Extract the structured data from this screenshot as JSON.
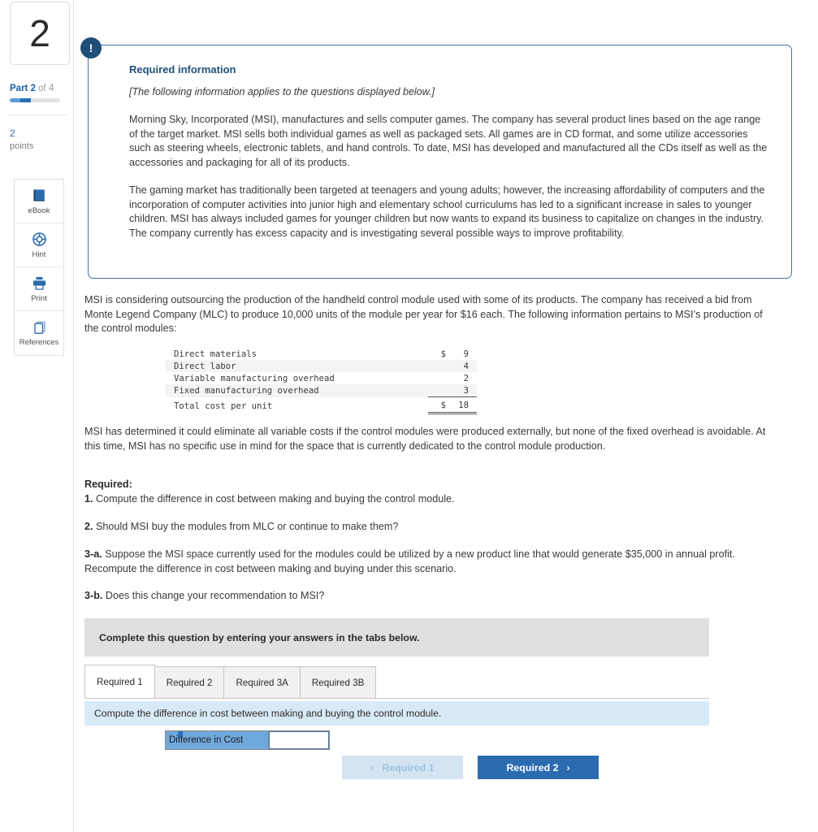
{
  "sidebar": {
    "question_number": "2",
    "part_prefix": "Part 2",
    "part_suffix": " of 4",
    "points_value": "2",
    "points_label": "points",
    "tools": [
      {
        "label": "eBook",
        "icon": "ebook-icon"
      },
      {
        "label": "Hint",
        "icon": "lifebuoy-icon"
      },
      {
        "label": "Print",
        "icon": "printer-icon"
      },
      {
        "label": "References",
        "icon": "copy-pages-icon"
      }
    ]
  },
  "required_information": {
    "badge": "!",
    "title": "Required information",
    "italic_note": "[The following information applies to the questions displayed below.]",
    "paragraphs": [
      "Morning Sky, Incorporated (MSI), manufactures and sells computer games. The company has several product lines based on the age range of the target market. MSI sells both individual games as well as packaged sets. All games are in CD format, and some utilize accessories such as steering wheels, electronic tablets, and hand controls. To date, MSI has developed and manufactured all the CDs itself as well as the accessories and packaging for all of its products.",
      "The gaming market has traditionally been targeted at teenagers and young adults; however, the increasing affordability of computers and the incorporation of computer activities into junior high and elementary school curriculums has led to a significant increase in sales to younger children. MSI has always included games for younger children but now wants to expand its business to capitalize on changes in the industry. The company currently has excess capacity and is investigating several possible ways to improve profitability."
    ]
  },
  "body": {
    "outsourcing_paragraph": "MSI is considering outsourcing the production of the handheld control module used with some of its products. The company has received a bid from Monte Legend Company (MLC) to produce 10,000 units of the module per year for $16 each. The following information pertains to MSI’s production of the control modules:",
    "eliminate_paragraph": "MSI has determined it could eliminate all variable costs if the control modules were produced externally, but none of the fixed overhead is avoidable. At this time, MSI has no specific use in mind for the space that is currently dedicated to the control module production."
  },
  "cost_table": {
    "rows": [
      {
        "label": "Direct materials",
        "currency": "$",
        "value": "9"
      },
      {
        "label": "Direct labor",
        "currency": "",
        "value": "4"
      },
      {
        "label": "Variable manufacturing overhead",
        "currency": "",
        "value": "2"
      },
      {
        "label": "Fixed manufacturing overhead",
        "currency": "",
        "value": "3"
      }
    ],
    "total": {
      "label": "Total cost per unit",
      "currency": "$",
      "value": "18"
    }
  },
  "required_section": {
    "heading": "Required:",
    "items": [
      {
        "number": "1.",
        "text": " Compute the difference in cost between making and buying the control module."
      },
      {
        "number": "2.",
        "text": " Should MSI buy the modules from MLC or continue to make them?"
      },
      {
        "number": "3-a.",
        "text": " Suppose the MSI space currently used for the modules could be utilized by a new product line that would generate $35,000 in annual profit. Recompute the difference in cost between making and buying under this scenario."
      },
      {
        "number": "3-b.",
        "text": " Does this change your recommendation to MSI?"
      }
    ]
  },
  "answer_panel": {
    "complete_bar": "Complete this question by entering your answers in the tabs below.",
    "tabs": [
      {
        "label": "Required 1",
        "active": true
      },
      {
        "label": "Required 2",
        "active": false
      },
      {
        "label": "Required 3A",
        "active": false
      },
      {
        "label": "Required 3B",
        "active": false
      }
    ],
    "tab_prompt": "Compute the difference in cost between making and buying the control module.",
    "answer_label": "Difference in Cost",
    "answer_value": "",
    "nav_prev": {
      "label": "Required 1",
      "chevron": "‹"
    },
    "nav_next": {
      "label": "Required 2",
      "chevron": "›"
    }
  },
  "colors": {
    "accent_blue": "#2b6cb0",
    "dark_navy": "#1f4e79",
    "tab_prompt_blue": "#d9eaf7",
    "answer_label_blue": "#6fa8dc"
  }
}
